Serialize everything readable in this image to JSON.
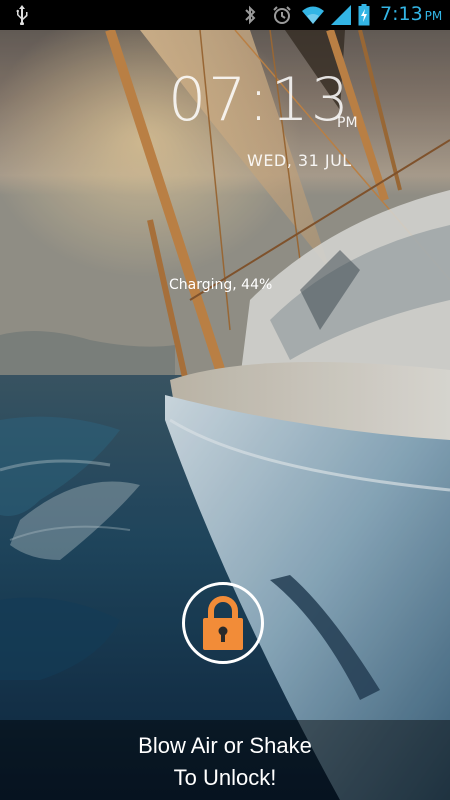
{
  "status_bar": {
    "icons": [
      "usb-icon",
      "bluetooth-icon",
      "alarm-icon",
      "wifi-icon",
      "signal-icon",
      "battery-charging-icon"
    ],
    "time": "7:13",
    "ampm": "PM",
    "accent_color": "#33b5e5"
  },
  "lockscreen": {
    "clock": "07:13",
    "ampm": "PM",
    "date": "WED, 31 JUL",
    "charging": "Charging, 44%",
    "lock_icon": "padlock-icon",
    "lock_color": "#f28c38",
    "unlock_line1": "Blow Air or Shake",
    "unlock_line2": "To Unlock!"
  }
}
